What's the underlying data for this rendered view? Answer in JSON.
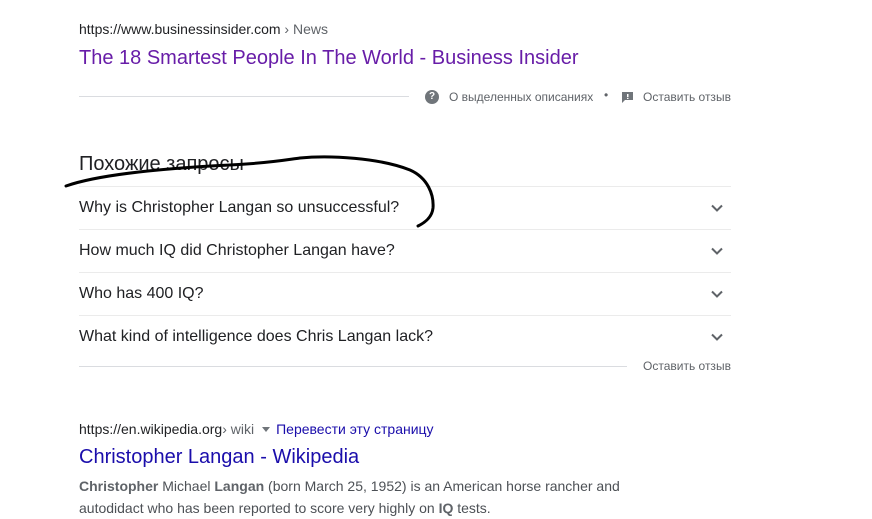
{
  "result1": {
    "cite_domain": "https://www.businessinsider.com",
    "cite_path": " › News",
    "title": "The 18 Smartest People In The World - Business Insider"
  },
  "featured": {
    "help_label": "О выделенных описаниях",
    "separator": "•",
    "feedback_label": "Оставить отзыв"
  },
  "related": {
    "heading": "Похожие запросы",
    "questions": [
      "Why is Christopher Langan so unsuccessful?",
      "How much IQ did Christopher Langan have?",
      "Who has 400 IQ?",
      "What kind of intelligence does Chris Langan lack?"
    ],
    "feedback_label": "Оставить отзыв"
  },
  "result2": {
    "cite_domain": "https://en.wikipedia.org",
    "cite_path": " › wiki",
    "translate_label": "Перевести эту страницу",
    "title": "Christopher Langan - Wikipedia",
    "snippet_b1": "Christopher",
    "snippet_t1": " Michael ",
    "snippet_b2": "Langan",
    "snippet_t2": " (born March 25, 1952) is an American horse rancher and autodidact who has been reported to score very highly on ",
    "snippet_b3": "IQ",
    "snippet_t3": " tests."
  },
  "colors": {
    "visited_link": "#681da8",
    "link": "#1a0dab",
    "annotation_ink": "#000000"
  },
  "icons": {
    "help": "question-circle-icon",
    "feedback": "feedback-flag-icon",
    "expand": "chevron-down-icon",
    "translate_toggle": "caret-down-icon"
  }
}
